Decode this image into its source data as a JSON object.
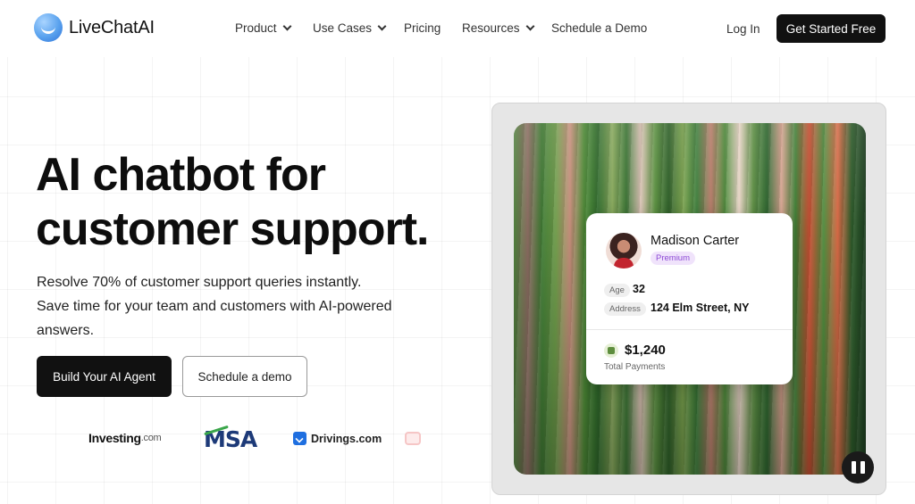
{
  "header": {
    "brand": "LiveChatAI",
    "nav": [
      {
        "label": "Product",
        "dropdown": true
      },
      {
        "label": "Use Cases",
        "dropdown": true
      },
      {
        "label": "Pricing",
        "dropdown": false
      },
      {
        "label": "Resources",
        "dropdown": true
      },
      {
        "label": "Schedule a Demo",
        "dropdown": false
      }
    ],
    "login_label": "Log In",
    "cta_label": "Get Started Free"
  },
  "hero": {
    "title_line1": "AI chatbot for",
    "title_line2": "customer support.",
    "sub_line1": "Resolve 70% of customer support queries instantly.",
    "sub_line2": "Save time for your team and customers with AI-powered",
    "sub_line3": "answers.",
    "primary_label": "Build Your AI Agent",
    "secondary_label": "Schedule a demo"
  },
  "brands": {
    "investing_main": "Investing",
    "investing_suffix": ".com",
    "msa": "MSA",
    "drivings": "Drivings.com"
  },
  "profile_card": {
    "name": "Madison Carter",
    "tier": "Premium",
    "age_label": "Age",
    "age_value": "32",
    "address_label": "Address",
    "address_value": "124 Elm Street, NY",
    "total_amount": "$1,240",
    "total_label": "Total Payments"
  },
  "colors": {
    "primary": "#111111",
    "logo_blue": "#2f73d9",
    "badge_purple": "#8d4bd6",
    "msa_blue": "#1d3a78",
    "msa_green": "#3aa64a"
  },
  "icons": {
    "logo": "smile-circle-icon",
    "dropdown": "chevron-down-icon",
    "video_control": "pause-icon",
    "payments": "shopify-bag-icon"
  }
}
